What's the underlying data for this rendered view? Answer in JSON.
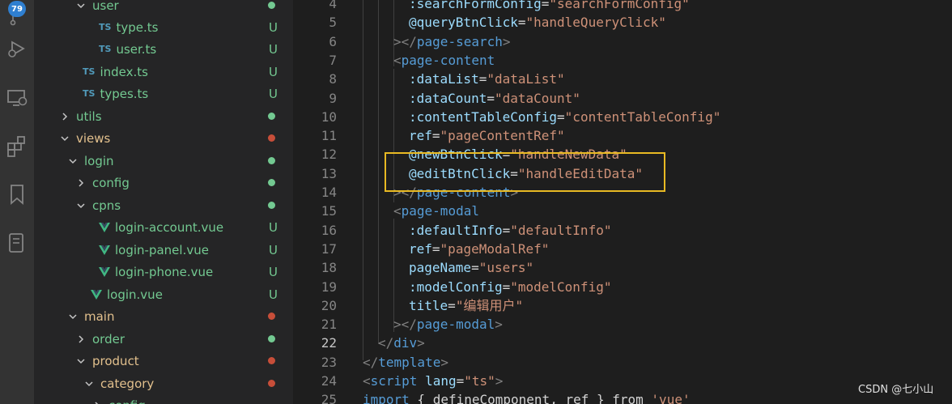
{
  "activity_bar": {
    "badge": "79",
    "icons": [
      "source-control-icon",
      "run-debug-icon",
      "remote-explorer-icon",
      "extensions-icon",
      "bookmarks-icon",
      "database-icon"
    ]
  },
  "explorer": {
    "rows": [
      {
        "label": "user",
        "type": "folder-open",
        "depth": 2,
        "status": "dot",
        "status_color": "#73c991",
        "label_color": "#73c991"
      },
      {
        "label": "type.ts",
        "type": "ts",
        "depth": 3,
        "status": "U",
        "label_color": "#73c991"
      },
      {
        "label": "user.ts",
        "type": "ts",
        "depth": 3,
        "status": "U",
        "label_color": "#73c991"
      },
      {
        "label": "index.ts",
        "type": "ts",
        "depth": 1,
        "status": "U",
        "label_color": "#73c991"
      },
      {
        "label": "types.ts",
        "type": "ts",
        "depth": 1,
        "status": "U",
        "label_color": "#73c991"
      },
      {
        "label": "utils",
        "type": "folder-closed",
        "depth": 0,
        "status": "dot",
        "status_color": "#73c991",
        "label_color": "#73c991"
      },
      {
        "label": "views",
        "type": "folder-open",
        "depth": 0,
        "status": "dot",
        "status_color": "#c74e39",
        "label_color": "#e2c08d"
      },
      {
        "label": "login",
        "type": "folder-open",
        "depth": 1,
        "status": "dot",
        "status_color": "#73c991",
        "label_color": "#73c991"
      },
      {
        "label": "config",
        "type": "folder-closed",
        "depth": 2,
        "status": "dot",
        "status_color": "#73c991",
        "label_color": "#73c991"
      },
      {
        "label": "cpns",
        "type": "folder-open",
        "depth": 2,
        "status": "dot",
        "status_color": "#73c991",
        "label_color": "#73c991"
      },
      {
        "label": "login-account.vue",
        "type": "vue",
        "depth": 3,
        "status": "U",
        "label_color": "#73c991"
      },
      {
        "label": "login-panel.vue",
        "type": "vue",
        "depth": 3,
        "status": "U",
        "label_color": "#73c991"
      },
      {
        "label": "login-phone.vue",
        "type": "vue",
        "depth": 3,
        "status": "U",
        "label_color": "#73c991"
      },
      {
        "label": "login.vue",
        "type": "vue",
        "depth": 2,
        "status": "U",
        "label_color": "#73c991"
      },
      {
        "label": "main",
        "type": "folder-open",
        "depth": 1,
        "status": "dot",
        "status_color": "#c74e39",
        "label_color": "#e2c08d"
      },
      {
        "label": "order",
        "type": "folder-closed",
        "depth": 2,
        "status": "dot",
        "status_color": "#73c991",
        "label_color": "#73c991"
      },
      {
        "label": "product",
        "type": "folder-open",
        "depth": 2,
        "status": "dot",
        "status_color": "#c74e39",
        "label_color": "#e2c08d"
      },
      {
        "label": "category",
        "type": "folder-open",
        "depth": 3,
        "status": "dot",
        "status_color": "#c74e39",
        "label_color": "#e2c08d"
      },
      {
        "label": "config",
        "type": "folder-closed",
        "depth": 4,
        "status": "",
        "label_color": "#73c991"
      }
    ]
  },
  "editor": {
    "lines": [
      {
        "n": "4",
        "indent": 3,
        "parts": [
          [
            ":searchFormConfig",
            "attr"
          ],
          [
            "=",
            "op"
          ],
          [
            "\"searchFormConfig\"",
            "str"
          ]
        ]
      },
      {
        "n": "5",
        "indent": 3,
        "parts": [
          [
            "@queryBtnClick",
            "attr"
          ],
          [
            "=",
            "op"
          ],
          [
            "\"handleQueryClick\"",
            "str"
          ]
        ]
      },
      {
        "n": "6",
        "indent": 2,
        "parts": [
          [
            "></",
            "punct"
          ],
          [
            "page-search",
            "tag"
          ],
          [
            ">",
            "punct"
          ]
        ]
      },
      {
        "n": "7",
        "indent": 2,
        "parts": [
          [
            "<",
            "punct"
          ],
          [
            "page-content",
            "tag"
          ]
        ]
      },
      {
        "n": "8",
        "indent": 3,
        "parts": [
          [
            ":dataList",
            "attr"
          ],
          [
            "=",
            "op"
          ],
          [
            "\"dataList\"",
            "str"
          ]
        ]
      },
      {
        "n": "9",
        "indent": 3,
        "parts": [
          [
            ":dataCount",
            "attr"
          ],
          [
            "=",
            "op"
          ],
          [
            "\"dataCount\"",
            "str"
          ]
        ]
      },
      {
        "n": "10",
        "indent": 3,
        "parts": [
          [
            ":contentTableConfig",
            "attr"
          ],
          [
            "=",
            "op"
          ],
          [
            "\"contentTableConfig\"",
            "str"
          ]
        ]
      },
      {
        "n": "11",
        "indent": 3,
        "parts": [
          [
            "ref",
            "attr"
          ],
          [
            "=",
            "op"
          ],
          [
            "\"pageContentRef\"",
            "str"
          ]
        ]
      },
      {
        "n": "12",
        "indent": 3,
        "parts": [
          [
            "@newBtnClick",
            "attr"
          ],
          [
            "=",
            "op"
          ],
          [
            "\"handleNewData\"",
            "str"
          ]
        ]
      },
      {
        "n": "13",
        "indent": 3,
        "parts": [
          [
            "@editBtnClick",
            "attr"
          ],
          [
            "=",
            "op"
          ],
          [
            "\"handleEditData\"",
            "str"
          ]
        ]
      },
      {
        "n": "14",
        "indent": 2,
        "parts": [
          [
            "></",
            "punct"
          ],
          [
            "page-content",
            "tag"
          ],
          [
            ">",
            "punct"
          ]
        ]
      },
      {
        "n": "15",
        "indent": 2,
        "parts": [
          [
            "<",
            "punct"
          ],
          [
            "page-modal",
            "tag"
          ]
        ]
      },
      {
        "n": "16",
        "indent": 3,
        "parts": [
          [
            ":defaultInfo",
            "attr"
          ],
          [
            "=",
            "op"
          ],
          [
            "\"defaultInfo\"",
            "str"
          ]
        ]
      },
      {
        "n": "17",
        "indent": 3,
        "parts": [
          [
            "ref",
            "attr"
          ],
          [
            "=",
            "op"
          ],
          [
            "\"pageModalRef\"",
            "str"
          ]
        ]
      },
      {
        "n": "18",
        "indent": 3,
        "parts": [
          [
            "pageName",
            "attr"
          ],
          [
            "=",
            "op"
          ],
          [
            "\"users\"",
            "str"
          ]
        ]
      },
      {
        "n": "19",
        "indent": 3,
        "parts": [
          [
            ":modelConfig",
            "attr"
          ],
          [
            "=",
            "op"
          ],
          [
            "\"modelConfig\"",
            "str"
          ]
        ]
      },
      {
        "n": "20",
        "indent": 3,
        "parts": [
          [
            "title",
            "attr"
          ],
          [
            "=",
            "op"
          ],
          [
            "\"编辑用户\"",
            "str"
          ]
        ]
      },
      {
        "n": "21",
        "indent": 2,
        "parts": [
          [
            "></",
            "punct"
          ],
          [
            "page-modal",
            "tag"
          ],
          [
            ">",
            "punct"
          ]
        ]
      },
      {
        "n": "22",
        "indent": 1,
        "active": true,
        "parts": [
          [
            "</",
            "punct"
          ],
          [
            "div",
            "tag"
          ],
          [
            ">",
            "punct"
          ]
        ]
      },
      {
        "n": "23",
        "indent": 0,
        "parts": [
          [
            "</",
            "punct"
          ],
          [
            "template",
            "tag"
          ],
          [
            ">",
            "punct"
          ]
        ]
      },
      {
        "n": "24",
        "indent": 0,
        "parts": [
          [
            "<",
            "punct"
          ],
          [
            "script",
            "tag"
          ],
          [
            " ",
            "op"
          ],
          [
            "lang",
            "attr"
          ],
          [
            "=",
            "op"
          ],
          [
            "\"ts\"",
            "str"
          ],
          [
            ">",
            "punct"
          ]
        ]
      },
      {
        "n": "25",
        "indent": 0,
        "parts": [
          [
            "import",
            "tag"
          ],
          [
            " { defineComponent, ref } from ",
            "op"
          ],
          [
            "'vue'",
            "str"
          ]
        ]
      }
    ]
  },
  "watermark": "CSDN @七小山"
}
